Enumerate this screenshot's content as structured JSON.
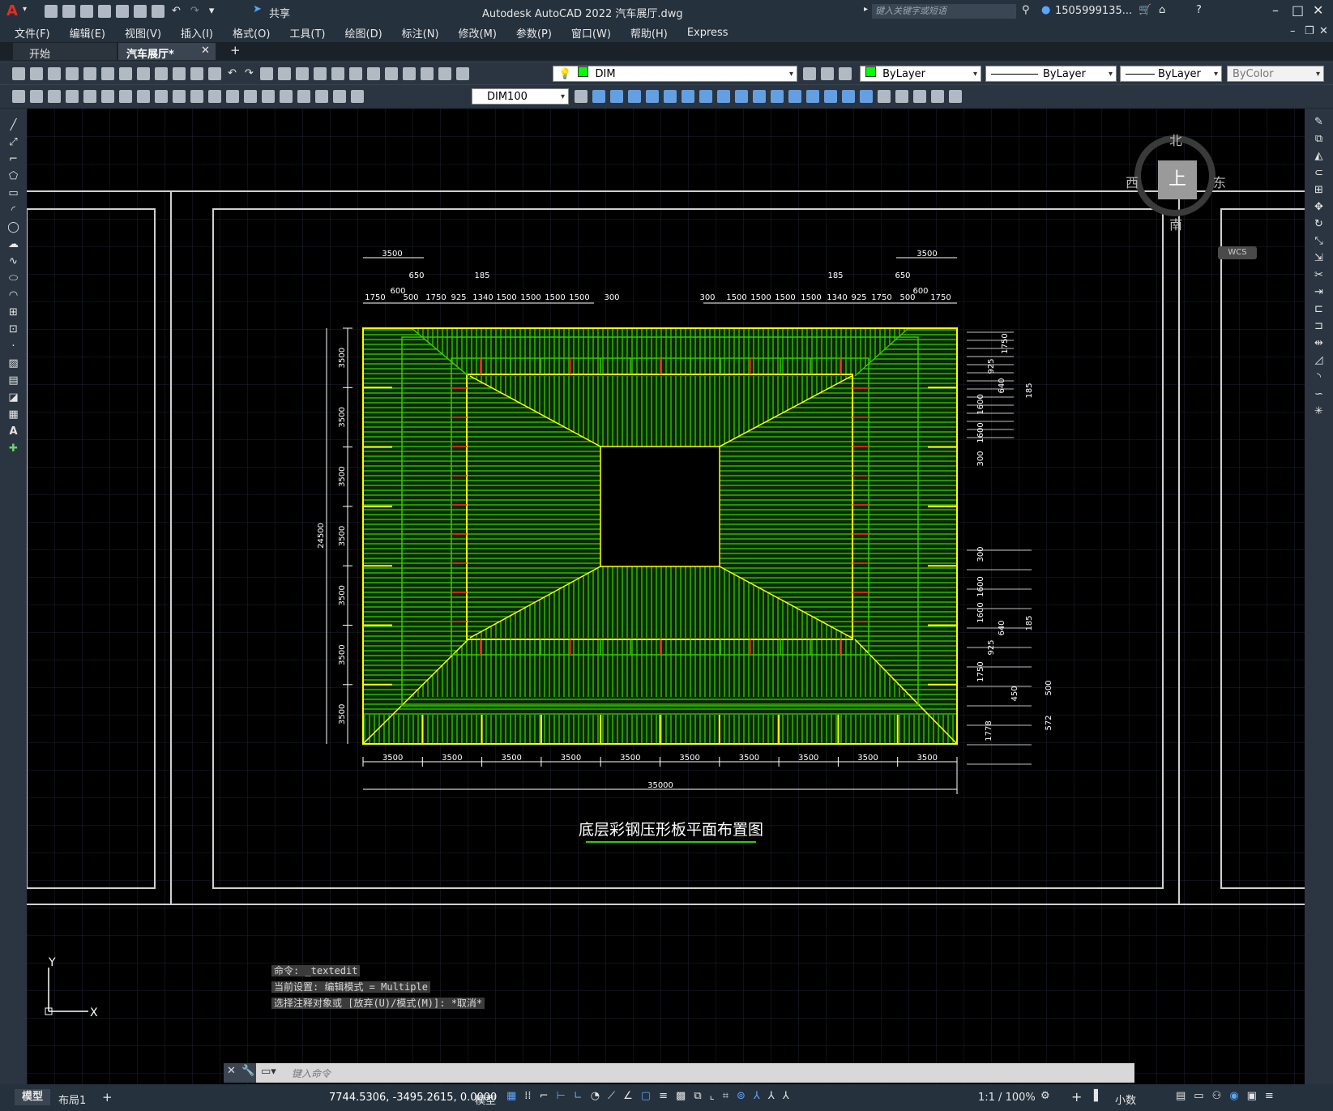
{
  "app": {
    "title": "Autodesk AutoCAD 2022    汽车展厅.dwg",
    "share_label": "共享",
    "search_placeholder": "键入关键字或短语",
    "user": "1505999135...",
    "logo": "A"
  },
  "menu": [
    "文件(F)",
    "编辑(E)",
    "视图(V)",
    "插入(I)",
    "格式(O)",
    "工具(T)",
    "绘图(D)",
    "标注(N)",
    "修改(M)",
    "参数(P)",
    "窗口(W)",
    "帮助(H)",
    "Express"
  ],
  "tabs": [
    {
      "label": "开始"
    },
    {
      "label": "汽车展厅*"
    }
  ],
  "toolbar": {
    "layer": "DIM",
    "color": "ByLayer",
    "linetype": "ByLayer",
    "lineweight": "ByLayer",
    "plotstyle": "ByColor",
    "dimstyle": "DIM100"
  },
  "viewcube": {
    "north": "北",
    "south": "南",
    "east": "东",
    "west": "西",
    "top": "上",
    "wcs": "WCS"
  },
  "drawing": {
    "title": "底层彩钢压形板平面布置图",
    "top_dims_left": [
      "1750",
      "600",
      "500",
      "1750",
      "925",
      "1340",
      "1500",
      "1500",
      "1500",
      "1500",
      "300"
    ],
    "top_dims_right": [
      "300",
      "1500",
      "1500",
      "1500",
      "1500",
      "1340",
      "925",
      "1750",
      "500",
      "600",
      "1750"
    ],
    "top_upper_left": [
      "3500",
      "650",
      "185"
    ],
    "top_upper_right": [
      "185",
      "650",
      "3500"
    ],
    "bottom_dims": [
      "3500",
      "3500",
      "3500",
      "3500",
      "3500",
      "3500",
      "3500",
      "3500",
      "3500",
      "3500"
    ],
    "bottom_total": "35000",
    "left_dims": [
      "3500",
      "3500",
      "3500",
      "3500",
      "3500",
      "3500",
      "3500"
    ],
    "left_total": "24500",
    "right_dims_upper": [
      "1750",
      "925",
      "640",
      "185",
      "1600",
      "1600",
      "300"
    ],
    "right_dims_lower": [
      "300",
      "1600",
      "1600",
      "640",
      "185",
      "925",
      "1750",
      "450",
      "500",
      "572",
      "1778"
    ]
  },
  "ucs": {
    "x": "X",
    "y": "Y"
  },
  "command": {
    "history": [
      "命令: _textedit",
      "当前设置: 编辑模式 = Multiple",
      "选择注释对象或 [放弃(U)/模式(M)]: *取消*"
    ],
    "placeholder": "键入命令"
  },
  "status": {
    "model_tab": "模型",
    "layout_tab": "布局1",
    "coords": "7744.5306, -3495.2615, 0.0000",
    "space": "模型",
    "scale": "1:1 / 100%",
    "units": "小数"
  },
  "colors": {
    "green": "#33cc00",
    "yellow": "#ffff00",
    "red": "#ff2020",
    "white": "#ffffff"
  }
}
